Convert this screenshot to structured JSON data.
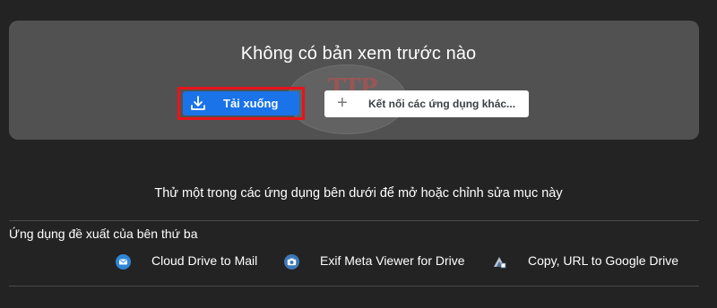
{
  "preview": {
    "title": "Không có bản xem trước nào",
    "download_label": "Tải xuống",
    "connect_label": "Kết nối các ứng dụng khác...",
    "watermark": "TTP"
  },
  "hint": "Thử một trong các ứng dụng bên dưới để mở hoặc chỉnh sửa mục này",
  "apps": {
    "heading": "Ứng dụng đề xuất của bên thứ ba",
    "items": [
      {
        "label": "Cloud Drive to Mail",
        "icon": "mail-icon"
      },
      {
        "label": "Exif Meta Viewer for Drive",
        "icon": "camera-icon"
      },
      {
        "label": "Copy, URL to Google Drive",
        "icon": "url-copy-icon"
      }
    ]
  },
  "colors": {
    "background": "#232323",
    "card": "#515151",
    "primary": "#1a73e8",
    "highlight": "#e8141a"
  }
}
